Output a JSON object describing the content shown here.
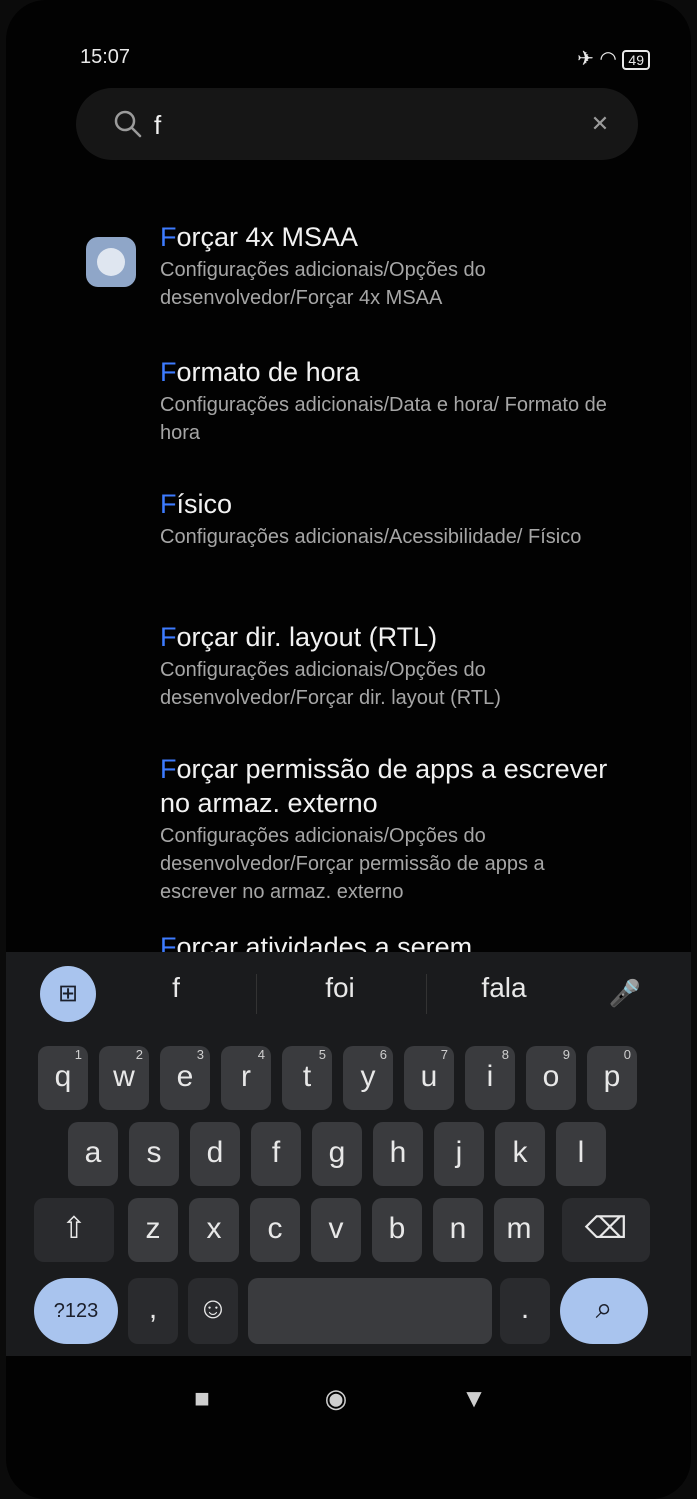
{
  "status_bar": {
    "time": "15:07",
    "battery": "49"
  },
  "search": {
    "value": "f",
    "placeholder": ""
  },
  "results": [
    {
      "highlight": "F",
      "rest": "orçar 4x MSAA",
      "path": "Configurações adicionais/Opções do desenvolvedor/Forçar 4x MSAA"
    },
    {
      "highlight": "F",
      "rest": "ormato de hora",
      "path": "Configurações adicionais/Data e hora/ Formato de hora"
    },
    {
      "highlight": "F",
      "rest": "ísico",
      "path": "Configurações adicionais/Acessibilidade/ Físico"
    },
    {
      "highlight": "F",
      "rest": "orçar dir. layout (RTL)",
      "path": "Configurações adicionais/Opções do desenvolvedor/Forçar dir. layout (RTL)"
    },
    {
      "highlight": "F",
      "rest": "orçar permissão de apps a escrever no armaz. externo",
      "path": "Configurações adicionais/Opções do desenvolvedor/Forçar permissão de apps a escrever no armaz. externo"
    },
    {
      "highlight": "F",
      "rest": "orçar atividades a serem",
      "path": ""
    }
  ],
  "suggestions": [
    "f",
    "foi",
    "fala"
  ],
  "keyboard": {
    "row1": [
      "q",
      "w",
      "e",
      "r",
      "t",
      "y",
      "u",
      "i",
      "o",
      "p"
    ],
    "row1_hints": [
      "1",
      "2",
      "3",
      "4",
      "5",
      "6",
      "7",
      "8",
      "9",
      "0"
    ],
    "row2": [
      "a",
      "s",
      "d",
      "f",
      "g",
      "h",
      "j",
      "k",
      "l"
    ],
    "row3": [
      "z",
      "x",
      "c",
      "v",
      "b",
      "n",
      "m"
    ],
    "symbols_label": "?123",
    "comma": ",",
    "period": "."
  }
}
